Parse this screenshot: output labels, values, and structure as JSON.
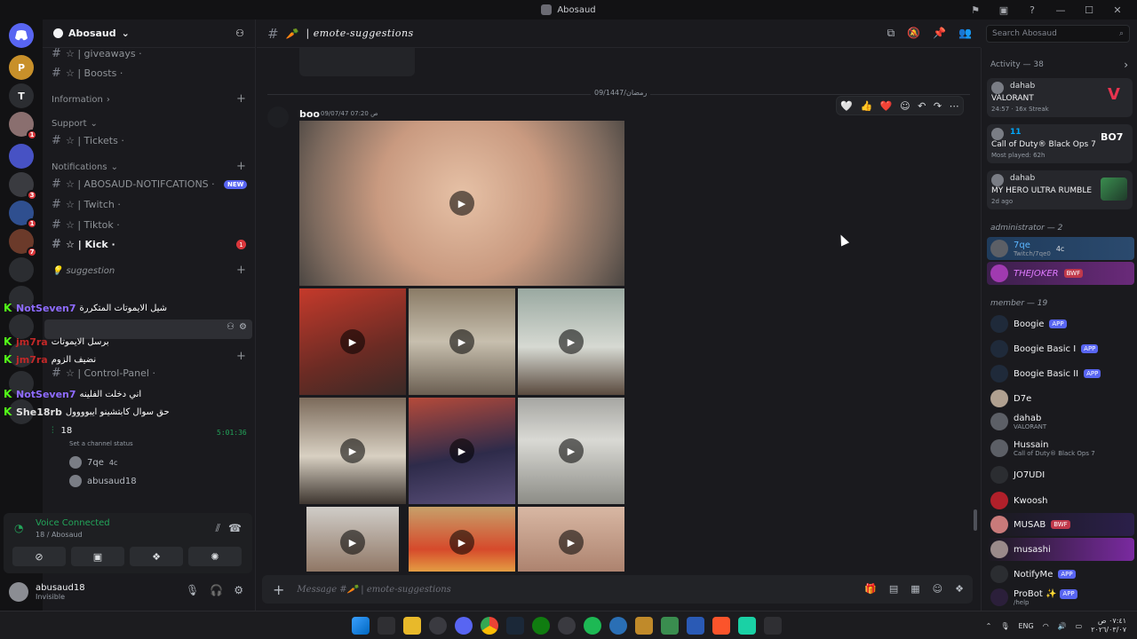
{
  "window": {
    "title": "Abosaud",
    "controls": [
      "⚑",
      "▣",
      "?",
      "—",
      "☐",
      "✕"
    ]
  },
  "server_rail": {
    "servers": [
      {
        "label": "",
        "badge": "",
        "color": "#5865f2",
        "icon": "discord-icon"
      },
      {
        "label": "P",
        "badge": "",
        "color": "#c8902a"
      },
      {
        "label": "T",
        "badge": "",
        "color": "#2b2d31"
      },
      {
        "label": "",
        "badge": "1",
        "color": "#8a6f6f"
      },
      {
        "label": "",
        "badge": "",
        "color": "#4752c4"
      },
      {
        "label": "",
        "badge": "3",
        "color": "#3a3b40"
      },
      {
        "label": "",
        "badge": "1",
        "color": "#2f4f8f"
      },
      {
        "label": "",
        "badge": "7",
        "color": "#6b3a2a"
      }
    ]
  },
  "sidebar": {
    "server_name": "Abosaud",
    "channels_top": [
      {
        "name": "☆ | giveaways ·"
      },
      {
        "name": "☆ | Boosts ·"
      }
    ],
    "cat_information": "Information",
    "cat_support": "Support",
    "ch_tickets": "☆ | Tickets ·",
    "cat_notifications": "Notifications",
    "ch_abosaud_notif": "☆ | ABOSAUD-NOTIFCATIONS ·",
    "new_badge": "NEW",
    "ch_twitch": "☆ | Twitch ·",
    "ch_tiktok": "☆ | Tiktok ·",
    "ch_kick": "☆ | Kick ·",
    "kick_badge": "1",
    "cat_suggestion": "suggestion",
    "ch_control": "☆ | Control-Panel ·",
    "voice_channel": "18",
    "voice_timer": "5:01:36",
    "voice_status": "Set a channel status",
    "voice_users": [
      "7qe",
      "abusaud18"
    ],
    "voice_user_tag": "4c"
  },
  "overlay_chat": [
    {
      "user": "NotSeven7",
      "color": "#8e6bff",
      "text": "شيل الايموتات المتكررة"
    },
    {
      "user": "jm7ra",
      "color": "#c22828",
      "text": "برسل الايموتات"
    },
    {
      "user": "jm7ra",
      "color": "#c22828",
      "text": "نضيف الزوم"
    },
    {
      "user": "NotSeven7",
      "color": "#8e6bff",
      "text": "اني دخلت الفلينه"
    },
    {
      "user": "She18rb",
      "color": "#e0e0e0",
      "text": "حق سوال كابتشينو ايبوووول"
    }
  ],
  "voice_panel": {
    "status": "Voice Connected",
    "channel": "18 / Abosaud"
  },
  "user_panel": {
    "name": "abusaud18",
    "status": "Invisible"
  },
  "chat_header": {
    "channel": "| emote-suggestions",
    "search_placeholder": "Search Abosaud"
  },
  "chat": {
    "date_divider": "09/1447/رمضان",
    "author": "boo",
    "timestamp": "09/07/47 07:20 ص",
    "reactions": [
      "🤍",
      "👍",
      "❤️",
      "☺",
      "↶",
      "↷",
      "⋯"
    ],
    "media_count": 12
  },
  "composer": {
    "placeholder": "Message #🥕 | emote-suggestions"
  },
  "activity": {
    "title": "Activity — 38",
    "cards": [
      {
        "user": "dahab",
        "game": "VALORANT",
        "sub": "24:57 · 16x Streak",
        "thumb": "#e8334f"
      },
      {
        "user": "11",
        "game": "Call of Duty® Black Ops 7",
        "sub": "Most played: 62h",
        "thumb": "#111"
      },
      {
        "user": "dahab",
        "game": "MY HERO ULTRA RUMBLE",
        "sub": "2d ago",
        "thumb": "#3a8d4f"
      }
    ]
  },
  "members": {
    "admin_header": "administrator — 2",
    "admins": [
      {
        "name": "7qe",
        "sub": "Twitch/7qe0",
        "tag": "4c",
        "bg": "#1f3b5b"
      },
      {
        "name": "THEJOKER",
        "sub": "",
        "tag": "BWF",
        "bg": "#3b1f4b"
      }
    ],
    "member_header": "member — 19",
    "list": [
      {
        "name": "Boogie",
        "sub": "",
        "tag": "APP"
      },
      {
        "name": "Boogie Basic I",
        "sub": "",
        "tag": "APP"
      },
      {
        "name": "Boogie Basic II",
        "sub": "",
        "tag": "APP"
      },
      {
        "name": "D7e",
        "sub": "",
        "tag": ""
      },
      {
        "name": "dahab",
        "sub": "VALORANT",
        "tag": ""
      },
      {
        "name": "Hussain",
        "sub": "Call of Duty® Black Ops 7",
        "tag": ""
      },
      {
        "name": "JO7UDI",
        "sub": "",
        "tag": ""
      },
      {
        "name": "Kwoosh",
        "sub": "",
        "tag": ""
      },
      {
        "name": "MUSAB",
        "sub": "",
        "tag": "BWF"
      },
      {
        "name": "musashi",
        "sub": "",
        "tag": ""
      },
      {
        "name": "NotifyMe",
        "sub": "",
        "tag": "APP"
      },
      {
        "name": "ProBot ✨",
        "sub": "/help",
        "tag": "APP"
      }
    ]
  },
  "taskbar": {
    "tray_lang": "ENG",
    "tray_time": "٠٧:٤١ ص",
    "tray_date": "٢٠٢٦/٠٣/٠٧"
  }
}
